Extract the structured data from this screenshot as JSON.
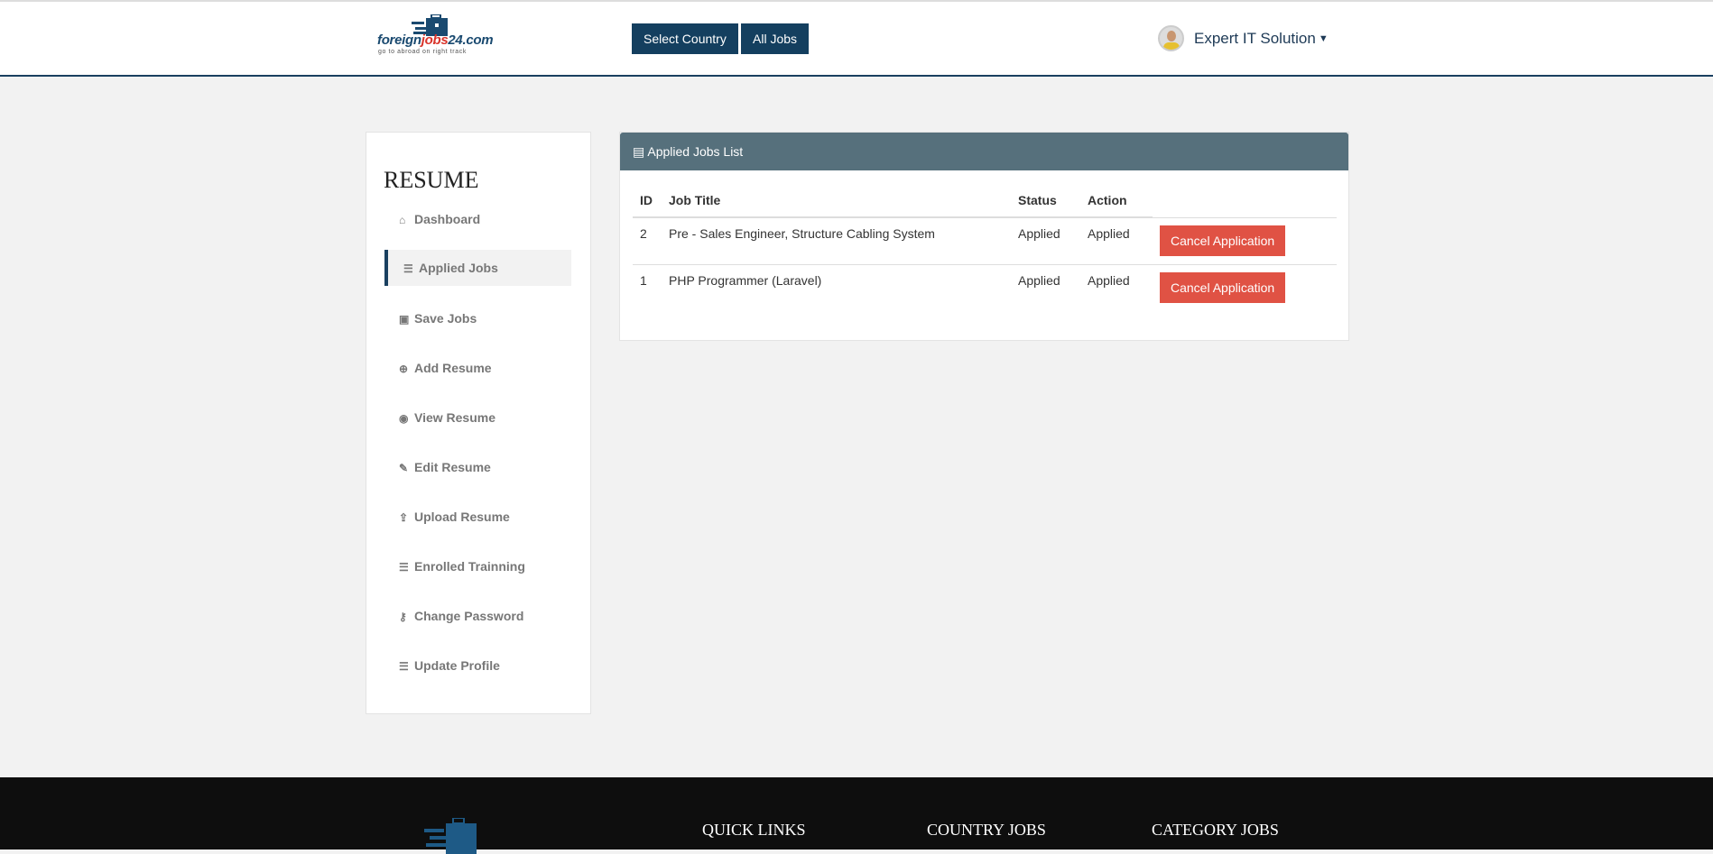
{
  "header": {
    "logo": {
      "brand_a": "foreign",
      "brand_b": "jobs",
      "brand_c": "24.com",
      "tagline": "go to abroad on right track"
    },
    "nav": [
      {
        "label": "Select Country"
      },
      {
        "label": "All Jobs"
      }
    ],
    "user": {
      "name": "Expert IT Solution"
    }
  },
  "sidebar": {
    "title": "RESUME",
    "items": [
      {
        "label": "Dashboard",
        "icon": "home-icon"
      },
      {
        "label": "Applied Jobs",
        "icon": "list-icon",
        "active": true
      },
      {
        "label": "Save Jobs",
        "icon": "save-icon"
      },
      {
        "label": "Add Resume",
        "icon": "plus-circle-icon"
      },
      {
        "label": "View Resume",
        "icon": "eye-icon"
      },
      {
        "label": "Edit Resume",
        "icon": "edit-icon"
      },
      {
        "label": "Upload Resume",
        "icon": "upload-icon"
      },
      {
        "label": "Enrolled Trainning",
        "icon": "list-icon"
      },
      {
        "label": "Change Password",
        "icon": "key-icon"
      },
      {
        "label": "Update Profile",
        "icon": "list-icon"
      }
    ]
  },
  "panel": {
    "title": "Applied Jobs List",
    "columns": [
      "ID",
      "Job Title",
      "Status",
      "Action"
    ],
    "rows": [
      {
        "id": "2",
        "title": "Pre - Sales Engineer, Structure Cabling System",
        "status": "Applied",
        "action": "Applied",
        "button": "Cancel Application"
      },
      {
        "id": "1",
        "title": "PHP Programmer (Laravel)",
        "status": "Applied",
        "action": "Applied",
        "button": "Cancel Application"
      }
    ]
  },
  "footer": {
    "headings": [
      "QUICK LINKS",
      "COUNTRY JOBS",
      "CATEGORY JOBS"
    ]
  },
  "colors": {
    "navy": "#143f5f",
    "panel_head": "#56707c",
    "danger": "#e05244",
    "footer": "#0e0e0e"
  }
}
